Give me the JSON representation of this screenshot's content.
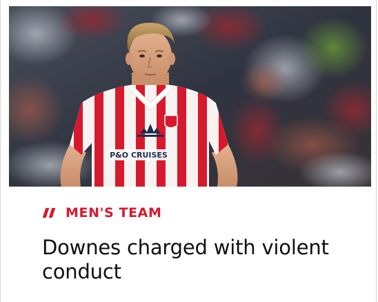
{
  "article": {
    "image": {
      "subject": "football-player-portrait",
      "shirt_sponsor": "P&O CRUISES"
    },
    "category": {
      "marker_icon": "double-slash-icon",
      "label": "MEN'S TEAM"
    },
    "headline": "Downes charged with violent conduct"
  },
  "colors": {
    "accent": "#d7192e",
    "headline": "#0f0f14",
    "background": "#ffffff"
  }
}
